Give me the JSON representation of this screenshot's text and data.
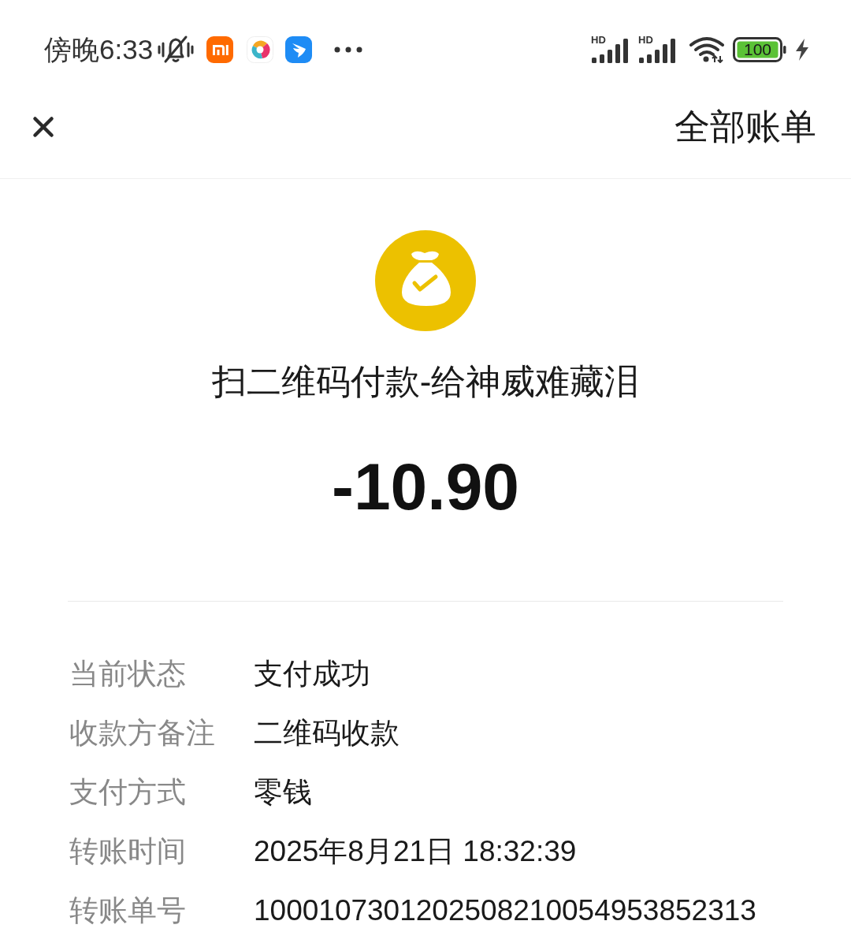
{
  "status_bar": {
    "time": "傍晚6:33",
    "signals": [
      {
        "label": "HD"
      },
      {
        "label": "HD"
      }
    ],
    "battery": {
      "text": "100"
    }
  },
  "header": {
    "action": "全部账单"
  },
  "payment": {
    "title": "扫二维码付款-给神威难藏泪",
    "amount": "-10.90"
  },
  "details": [
    {
      "label": "当前状态",
      "value": "支付成功"
    },
    {
      "label": "收款方备注",
      "value": "二维码收款"
    },
    {
      "label": "支付方式",
      "value": "零钱"
    },
    {
      "label": "转账时间",
      "value": "2025年8月21日 18:32:39"
    },
    {
      "label": "转账单号",
      "value": "1000107301202508210054953852313"
    }
  ]
}
